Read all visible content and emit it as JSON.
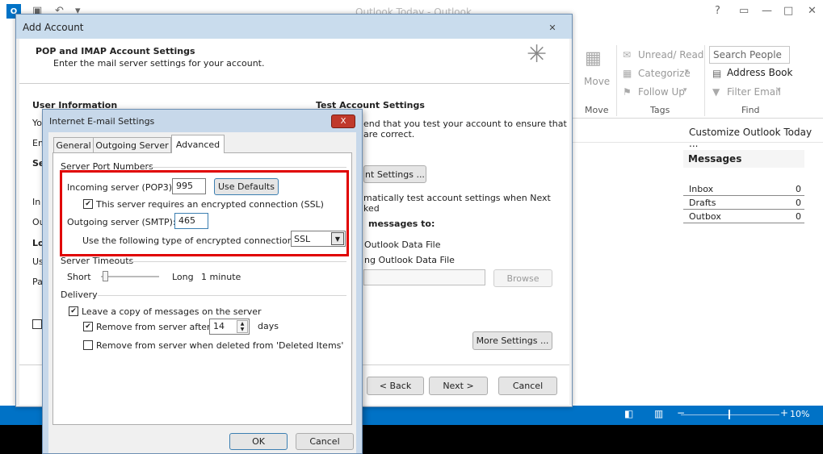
{
  "app": {
    "title": "Outlook Today - Outlook",
    "icon_text": "O"
  },
  "ribbon": {
    "move_label": "Move",
    "move_group": "Move",
    "unread_read": "Unread/ Read",
    "categorize": "Categorize",
    "follow_up": "Follow Up",
    "tags_group": "Tags",
    "search_people_placeholder": "Search People",
    "address_book": "Address Book",
    "filter_email": "Filter Email",
    "find_group": "Find"
  },
  "content": {
    "customize": "Customize Outlook Today ...",
    "messages_title": "Messages",
    "rows": [
      {
        "name": "Inbox",
        "count": "0"
      },
      {
        "name": "Drafts",
        "count": "0"
      },
      {
        "name": "Outbox",
        "count": "0"
      }
    ]
  },
  "status": {
    "zoom": "10%"
  },
  "add_account": {
    "title": "Add Account",
    "heading": "POP and IMAP Account Settings",
    "subheading": "Enter the mail server settings for your account.",
    "user_info": "User Information",
    "test_settings": "Test Account Settings",
    "test_desc_1": "end that you test your account to ensure that",
    "test_desc_2": "are correct.",
    "test_button": "nt Settings ...",
    "auto_test_1": "matically test account settings when Next",
    "auto_test_2": "ked",
    "deliver_to": "messages to:",
    "deliver_opt_1": "Outlook Data File",
    "deliver_opt_2": "ng Outlook Data File",
    "browse": "Browse",
    "more_settings": "More Settings ...",
    "back": "< Back",
    "next": "Next >",
    "cancel": "Cancel",
    "left_labels": [
      "Yo",
      "Em",
      "Se",
      "In",
      "Ou",
      "Lo",
      "Us",
      "Pa"
    ]
  },
  "email_settings": {
    "title": "Internet E-mail Settings",
    "close": "X",
    "tabs": [
      "General",
      "Outgoing Server",
      "Advanced"
    ],
    "server_ports": "Server Port Numbers",
    "incoming_label": "Incoming server (POP3):",
    "incoming_value": "995",
    "use_defaults": "Use Defaults",
    "ssl_label": "This server requires an encrypted connection (SSL)",
    "outgoing_label": "Outgoing server (SMTP):",
    "outgoing_value": "465",
    "encryption_label": "Use the following type of encrypted connection:",
    "encryption_value": "SSL",
    "timeouts": "Server Timeouts",
    "short": "Short",
    "long": "Long",
    "timeout_value": "1 minute",
    "delivery": "Delivery",
    "leave_copy": "Leave a copy of messages on the server",
    "remove_after": "Remove from server after",
    "remove_days_value": "14",
    "days": "days",
    "remove_deleted": "Remove from server when deleted from 'Deleted Items'",
    "ok": "OK",
    "cancel": "Cancel"
  }
}
